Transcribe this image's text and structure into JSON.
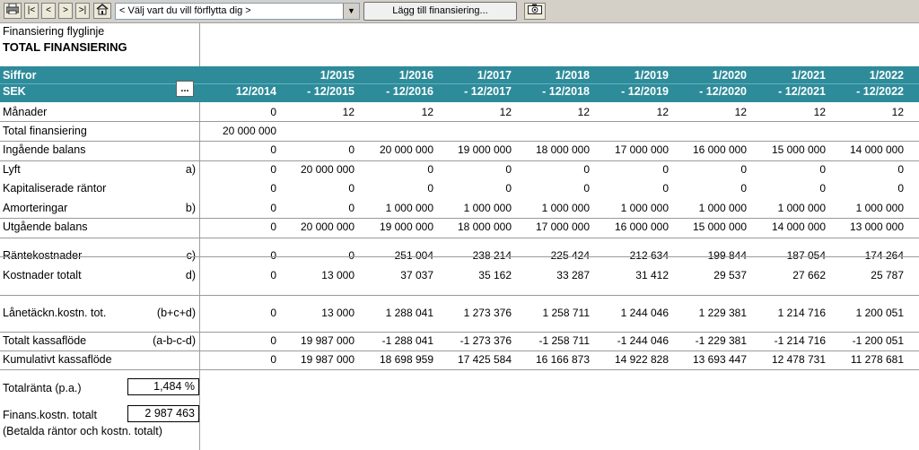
{
  "toolbar": {
    "print_icon": "printer-icon",
    "first_label": "|<",
    "prev_label": "<",
    "next_label": ">",
    "last_label": ">|",
    "home_icon": "home-icon",
    "nav_dropdown_value": "< Välj vart du vill förflytta dig >",
    "add_financing_label": "Lägg till finansiering...",
    "camera_icon": "camera-icon"
  },
  "title": {
    "line1": "Finansiering flyglinje",
    "line2": "TOTAL FINANSIERING"
  },
  "header": {
    "label1": "Siffror",
    "label2": "SEK",
    "dots_label": "...",
    "columns": [
      {
        "top": "",
        "bottom": "12/2014"
      },
      {
        "top": "1/2015",
        "bottom": "- 12/2015"
      },
      {
        "top": "1/2016",
        "bottom": "- 12/2016"
      },
      {
        "top": "1/2017",
        "bottom": "- 12/2017"
      },
      {
        "top": "1/2018",
        "bottom": "- 12/2018"
      },
      {
        "top": "1/2019",
        "bottom": "- 12/2019"
      },
      {
        "top": "1/2020",
        "bottom": "- 12/2020"
      },
      {
        "top": "1/2021",
        "bottom": "- 12/2021"
      },
      {
        "top": "1/2022",
        "bottom": "- 12/2022"
      }
    ]
  },
  "rows": [
    {
      "label": "Månader",
      "note": "",
      "values": [
        "0",
        "12",
        "12",
        "12",
        "12",
        "12",
        "12",
        "12",
        "12"
      ]
    },
    {
      "label": "Total finansiering",
      "note": "",
      "values": [
        "20 000 000",
        "",
        "",
        "",
        "",
        "",
        "",
        "",
        ""
      ]
    },
    {
      "label": "Ingående balans",
      "note": "",
      "values": [
        "0",
        "0",
        "20 000 000",
        "19 000 000",
        "18 000 000",
        "17 000 000",
        "16 000 000",
        "15 000 000",
        "14 000 000"
      ]
    },
    {
      "label": "Lyft",
      "note": "a)",
      "values": [
        "0",
        "20 000 000",
        "0",
        "0",
        "0",
        "0",
        "0",
        "0",
        "0"
      ]
    },
    {
      "label": "Kapitaliserade räntor",
      "note": "",
      "values": [
        "0",
        "0",
        "0",
        "0",
        "0",
        "0",
        "0",
        "0",
        "0"
      ]
    },
    {
      "label": "Amorteringar",
      "note": "b)",
      "values": [
        "0",
        "0",
        "1 000 000",
        "1 000 000",
        "1 000 000",
        "1 000 000",
        "1 000 000",
        "1 000 000",
        "1 000 000"
      ]
    },
    {
      "label": "Utgående balans",
      "note": "",
      "values": [
        "0",
        "20 000 000",
        "19 000 000",
        "18 000 000",
        "17 000 000",
        "16 000 000",
        "15 000 000",
        "14 000 000",
        "13 000 000"
      ]
    },
    {
      "label": "Räntekostnader",
      "note": "c)",
      "values": [
        "0",
        "0",
        "251 004",
        "238 214",
        "225 424",
        "212 634",
        "199 844",
        "187 054",
        "174 264"
      ]
    },
    {
      "label": "Kostnader totalt",
      "note": "d)",
      "values": [
        "0",
        "13 000",
        "37 037",
        "35 162",
        "33 287",
        "31 412",
        "29 537",
        "27 662",
        "25 787"
      ]
    },
    {
      "label": "Lånetäckn.kostn. tot.",
      "note": "(b+c+d)",
      "values": [
        "0",
        "13 000",
        "1 288 041",
        "1 273 376",
        "1 258 711",
        "1 244 046",
        "1 229 381",
        "1 214 716",
        "1 200 051"
      ]
    },
    {
      "label": "Totalt kassaflöde",
      "note": "(a-b-c-d)",
      "values": [
        "0",
        "19 987 000",
        "-1 288 041",
        "-1 273 376",
        "-1 258 711",
        "-1 244 046",
        "-1 229 381",
        "-1 214 716",
        "-1 200 051"
      ]
    },
    {
      "label": "Kumulativt kassaflöde",
      "note": "",
      "values": [
        "0",
        "19 987 000",
        "18 698 959",
        "17 425 584",
        "16 166 873",
        "14 922 828",
        "13 693 447",
        "12 478 731",
        "11 278 681"
      ]
    }
  ],
  "summary": {
    "total_interest_label": "Totalränta (p.a.)",
    "total_interest_value": "1,484 %",
    "fin_cost_label": "Finans.kostn. totalt",
    "fin_cost_value": "2 987 463",
    "fin_cost_note": "(Betalda räntor och kostn. totalt)"
  },
  "colors": {
    "header_bg": "#2e8b9a",
    "header_text": "#ffffff"
  }
}
